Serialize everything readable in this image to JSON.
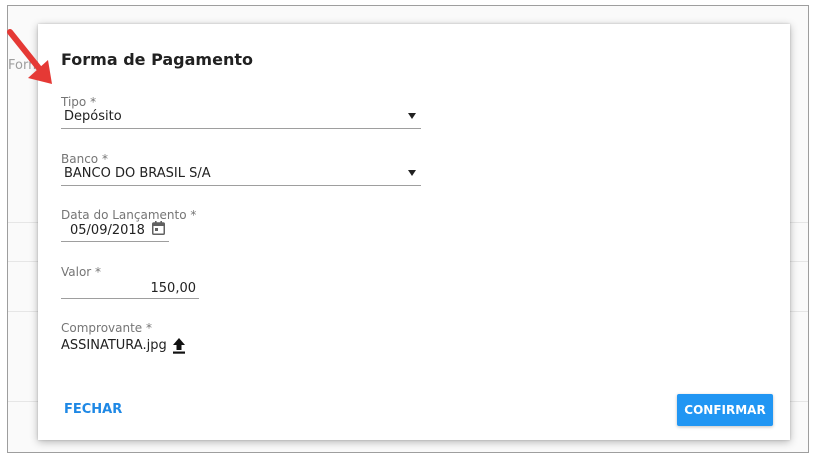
{
  "background": {
    "partial_label": "Form"
  },
  "dialog": {
    "title": "Forma de Pagamento",
    "fields": {
      "tipo": {
        "label": "Tipo *",
        "value": "Depósito"
      },
      "banco": {
        "label": "Banco *",
        "value": "BANCO DO BRASIL S/A"
      },
      "data": {
        "label": "Data do Lançamento *",
        "value": "05/09/2018"
      },
      "valor": {
        "label": "Valor *",
        "value": "150,00"
      },
      "comprovante": {
        "label": "Comprovante *",
        "file_name": "ASSINATURA.jpg"
      }
    },
    "buttons": {
      "fechar": "FECHAR",
      "confirmar": "CONFIRMAR"
    }
  },
  "colors": {
    "accent": "#2196f3",
    "link": "#1e88e5",
    "annotation": "#e53935"
  },
  "icons": [
    "chevron-down-icon",
    "calendar-icon",
    "upload-icon",
    "red-arrow-icon"
  ]
}
